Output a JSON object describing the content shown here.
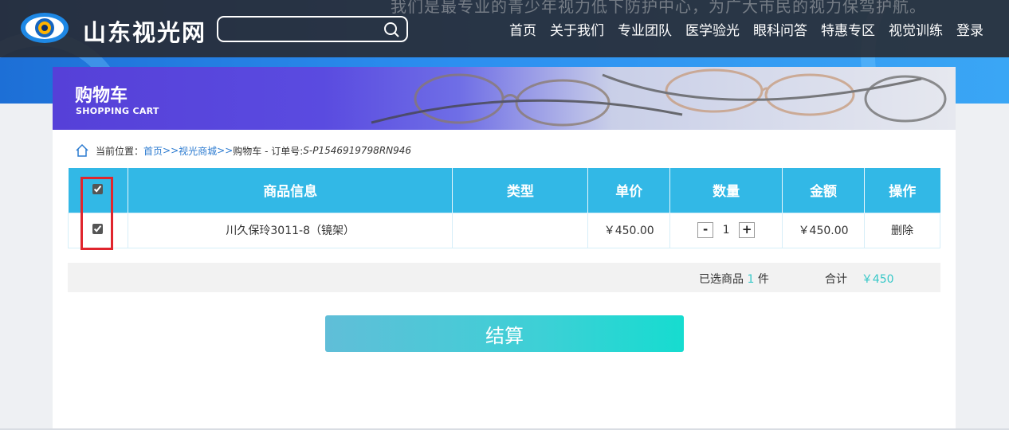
{
  "header": {
    "slogan": "我们是最专业的青少年视力低下防护中心，为广大市民的视力保驾护航。",
    "site_name": "山东视光网",
    "search_placeholder": "",
    "nav": [
      "首页",
      "关于我们",
      "专业团队",
      "医学验光",
      "眼科问答",
      "特惠专区",
      "视觉训练",
      "登录"
    ]
  },
  "banner": {
    "title": "购物车",
    "subtitle": "SHOPPING CART"
  },
  "breadcrumb": {
    "prefix": "当前位置：",
    "home": "首页",
    "sep1": " >> ",
    "shop": "视光商城",
    "sep2": " >>",
    "current": "购物车 - 订单号:",
    "order_no": "S-P1546919798RN946"
  },
  "table": {
    "headers": [
      "商品信息",
      "类型",
      "单价",
      "数量",
      "金额",
      "操作"
    ],
    "rows": [
      {
        "checked": true,
        "name": "川久保玲3011-8（镜架）",
        "type": "",
        "price": "￥450.00",
        "qty": "1",
        "amount": "￥450.00",
        "action": "删除"
      }
    ],
    "qty_minus": "-",
    "qty_plus": "+"
  },
  "summary": {
    "selected_label": "已选商品",
    "selected_count": "1",
    "selected_unit": "件",
    "total_label": "合计",
    "total_value": "￥450"
  },
  "checkout_label": "结算",
  "colors": {
    "header_bg": "#28282e",
    "table_header": "#32b8e6",
    "accent": "#38c8c8",
    "highlight": "#e0252d"
  }
}
